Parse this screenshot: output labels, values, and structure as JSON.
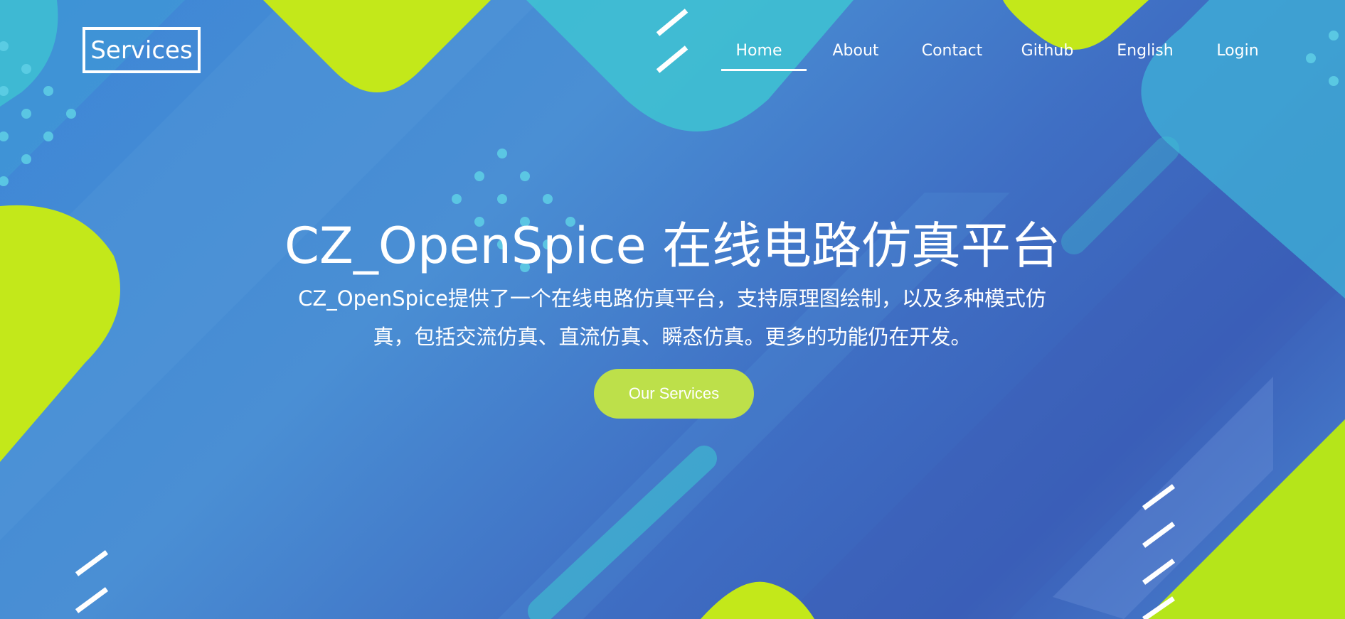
{
  "brand": {
    "label": "Services"
  },
  "nav": {
    "items": [
      {
        "label": "Home",
        "active": true
      },
      {
        "label": "About",
        "active": false
      },
      {
        "label": "Contact",
        "active": false
      },
      {
        "label": "Github",
        "active": false
      },
      {
        "label": "English",
        "active": false
      },
      {
        "label": "Login",
        "active": false
      }
    ]
  },
  "hero": {
    "title": "CZ_OpenSpice 在线电路仿真平台",
    "description": "CZ_OpenSpice提供了一个在线电路仿真平台，支持原理图绘制，以及多种模式仿真，包括交流仿真、直流仿真、瞬态仿真。更多的功能仍在开发。",
    "cta_label": "Our Services"
  },
  "colors": {
    "accent": "#c3e81a",
    "button": "#bde04a",
    "background": "#4a8fd4",
    "text": "#ffffff"
  }
}
